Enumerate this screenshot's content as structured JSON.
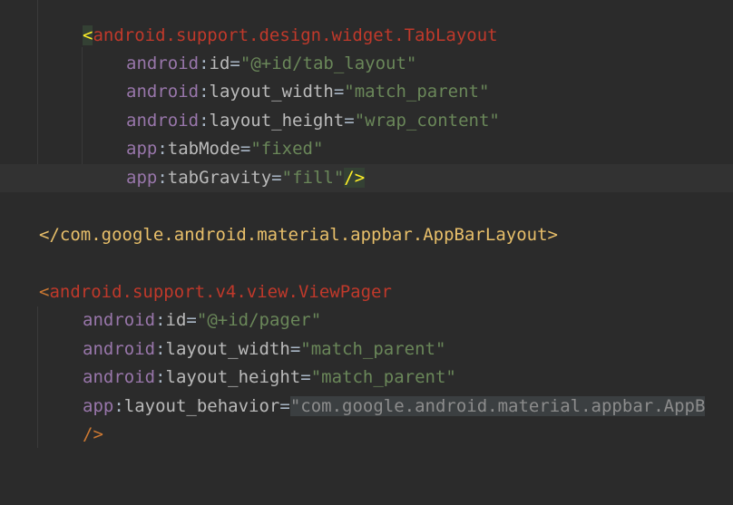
{
  "lines": [
    {
      "lt": "<",
      "tag": "android.support.design.widget.TabLayout"
    },
    {
      "ns": "android",
      "colon": ":",
      "attr": "id",
      "eq": "=",
      "val": "\"@+id/tab_layout\""
    },
    {
      "ns": "android",
      "colon": ":",
      "attr": "layout_width",
      "eq": "=",
      "val": "\"match_parent\""
    },
    {
      "ns": "android",
      "colon": ":",
      "attr": "layout_height",
      "eq": "=",
      "val": "\"wrap_content\""
    },
    {
      "ns": "app",
      "colon": ":",
      "attr": "tabMode",
      "eq": "=",
      "val": "\"fixed\""
    },
    {
      "ns": "app",
      "colon": ":",
      "attr": "tabGravity",
      "eq": "=",
      "val": "\"fill\"",
      "end": "/>"
    },
    {
      "close": "</com.google.android.material.appbar.AppBarLayout>"
    },
    {
      "lt": "<",
      "tag": "android.support.v4.view.ViewPager"
    },
    {
      "ns": "android",
      "colon": ":",
      "attr": "id",
      "eq": "=",
      "val": "\"@+id/pager\""
    },
    {
      "ns": "android",
      "colon": ":",
      "attr": "layout_width",
      "eq": "=",
      "val": "\"match_parent\""
    },
    {
      "ns": "android",
      "colon": ":",
      "attr": "layout_height",
      "eq": "=",
      "val": "\"match_parent\""
    },
    {
      "ns": "app",
      "colon": ":",
      "attr": "layout_behavior",
      "eq": "=",
      "val": "\"com.google.android.material.appbar.AppB"
    },
    {
      "end": "/>"
    }
  ],
  "colors": {
    "background": "#2b2b2b",
    "tag_bracket": "#cc7832",
    "tag_name": "#c0392b",
    "namespace": "#9876aa",
    "attribute": "#bababa",
    "string": "#6a8759",
    "brace_match": "#ffef28"
  }
}
